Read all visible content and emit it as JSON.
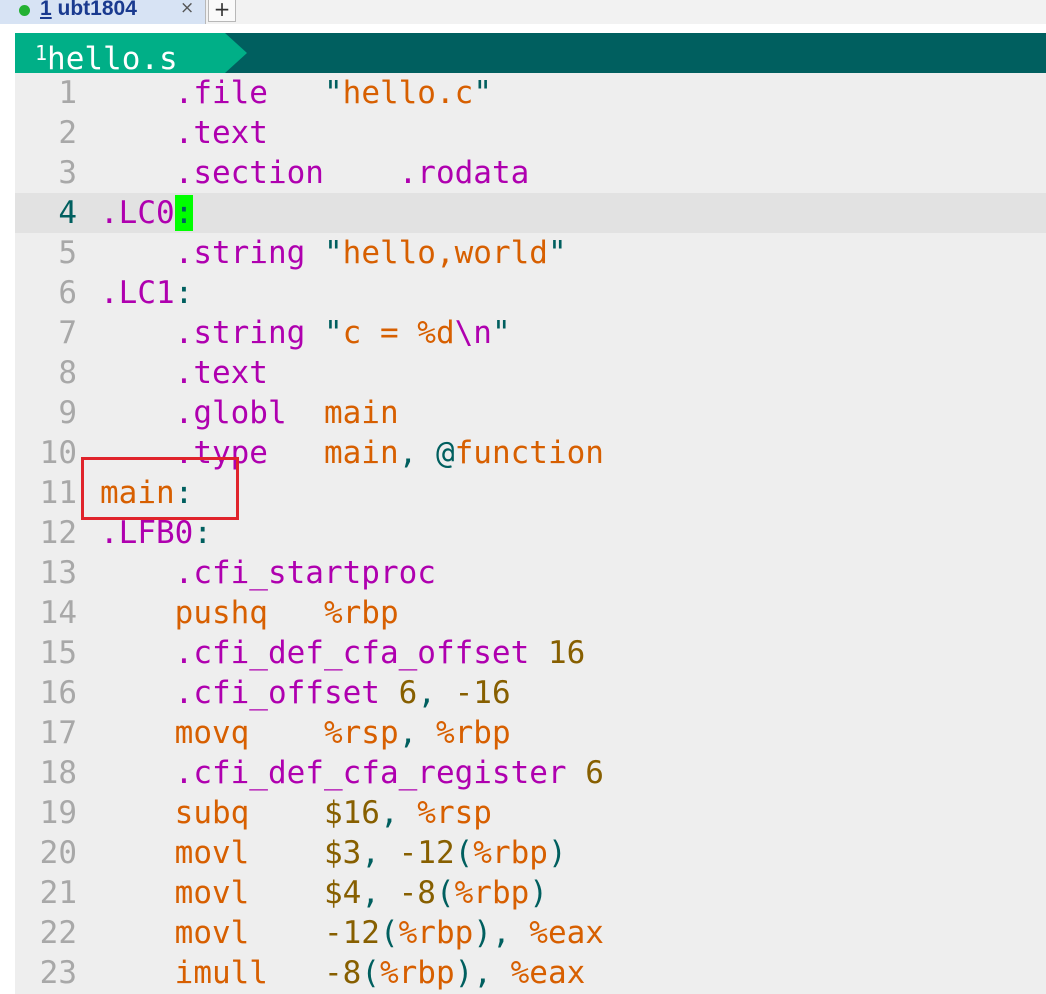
{
  "tab": {
    "number": "1",
    "title": "ubt1804",
    "close_icon": "×",
    "add_icon": "+"
  },
  "buffer": {
    "index": "1",
    "filename": "hello.s"
  },
  "lines": [
    {
      "n": "1",
      "tokens": [
        [
          "    ",
          ""
        ],
        [
          ".file",
          "c-dir"
        ],
        [
          "   ",
          ""
        ],
        [
          "\"",
          "c-q"
        ],
        [
          "hello.c",
          "c-str"
        ],
        [
          "\"",
          "c-q"
        ]
      ]
    },
    {
      "n": "2",
      "tokens": [
        [
          "    ",
          ""
        ],
        [
          ".text",
          "c-dir"
        ]
      ]
    },
    {
      "n": "3",
      "tokens": [
        [
          "    ",
          ""
        ],
        [
          ".section",
          "c-dir"
        ],
        [
          "    ",
          ""
        ],
        [
          ".rodata",
          "c-dir"
        ]
      ]
    },
    {
      "n": "4",
      "cursorline": true,
      "tokens": [
        [
          ".LC0",
          "c-lbl"
        ],
        [
          ":",
          "cursor"
        ]
      ]
    },
    {
      "n": "5",
      "tokens": [
        [
          "    ",
          ""
        ],
        [
          ".string",
          "c-dir"
        ],
        [
          " ",
          ""
        ],
        [
          "\"",
          "c-q"
        ],
        [
          "hello,world",
          "c-str"
        ],
        [
          "\"",
          "c-q"
        ]
      ]
    },
    {
      "n": "6",
      "tokens": [
        [
          ".LC1",
          "c-lbl"
        ],
        [
          ":",
          "c-punc"
        ]
      ]
    },
    {
      "n": "7",
      "tokens": [
        [
          "    ",
          ""
        ],
        [
          ".string",
          "c-dir"
        ],
        [
          " ",
          ""
        ],
        [
          "\"",
          "c-q"
        ],
        [
          "c = %d",
          "c-str"
        ],
        [
          "\\n",
          "c-esc"
        ],
        [
          "\"",
          "c-q"
        ]
      ]
    },
    {
      "n": "8",
      "tokens": [
        [
          "    ",
          ""
        ],
        [
          ".text",
          "c-dir"
        ]
      ]
    },
    {
      "n": "9",
      "tokens": [
        [
          "    ",
          ""
        ],
        [
          ".globl",
          "c-dir"
        ],
        [
          "  ",
          ""
        ],
        [
          "main",
          "c-sym"
        ]
      ]
    },
    {
      "n": "10",
      "tokens": [
        [
          "    ",
          ""
        ],
        [
          ".type",
          "c-dir"
        ],
        [
          "   ",
          ""
        ],
        [
          "main",
          "c-sym"
        ],
        [
          ", ",
          "c-punc"
        ],
        [
          "@",
          "c-at"
        ],
        [
          "function",
          "c-sym"
        ]
      ]
    },
    {
      "n": "11",
      "tokens": [
        [
          "main",
          "c-lblm"
        ],
        [
          ":",
          "c-punc"
        ]
      ]
    },
    {
      "n": "12",
      "tokens": [
        [
          ".LFB0",
          "c-lbl"
        ],
        [
          ":",
          "c-punc"
        ]
      ]
    },
    {
      "n": "13",
      "tokens": [
        [
          "    ",
          ""
        ],
        [
          ".cfi_startproc",
          "c-dir"
        ]
      ]
    },
    {
      "n": "14",
      "tokens": [
        [
          "    ",
          ""
        ],
        [
          "pushq",
          "c-op"
        ],
        [
          "   ",
          ""
        ],
        [
          "%rbp",
          "c-reg"
        ]
      ]
    },
    {
      "n": "15",
      "tokens": [
        [
          "    ",
          ""
        ],
        [
          ".cfi_def_cfa_offset",
          "c-dir"
        ],
        [
          " ",
          ""
        ],
        [
          "16",
          "c-num"
        ]
      ]
    },
    {
      "n": "16",
      "tokens": [
        [
          "    ",
          ""
        ],
        [
          ".cfi_offset",
          "c-dir"
        ],
        [
          " ",
          ""
        ],
        [
          "6",
          "c-num"
        ],
        [
          ", ",
          "c-punc"
        ],
        [
          "-16",
          "c-num"
        ]
      ]
    },
    {
      "n": "17",
      "tokens": [
        [
          "    ",
          ""
        ],
        [
          "movq",
          "c-op"
        ],
        [
          "    ",
          ""
        ],
        [
          "%rsp",
          "c-reg"
        ],
        [
          ", ",
          "c-punc"
        ],
        [
          "%rbp",
          "c-reg"
        ]
      ]
    },
    {
      "n": "18",
      "tokens": [
        [
          "    ",
          ""
        ],
        [
          ".cfi_def_cfa_register",
          "c-dir"
        ],
        [
          " ",
          ""
        ],
        [
          "6",
          "c-num"
        ]
      ]
    },
    {
      "n": "19",
      "tokens": [
        [
          "    ",
          ""
        ],
        [
          "subq",
          "c-op"
        ],
        [
          "    ",
          ""
        ],
        [
          "$16",
          "c-num"
        ],
        [
          ", ",
          "c-punc"
        ],
        [
          "%rsp",
          "c-reg"
        ]
      ]
    },
    {
      "n": "20",
      "tokens": [
        [
          "    ",
          ""
        ],
        [
          "movl",
          "c-op"
        ],
        [
          "    ",
          ""
        ],
        [
          "$3",
          "c-num"
        ],
        [
          ", ",
          "c-punc"
        ],
        [
          "-12",
          "c-num"
        ],
        [
          "(",
          "c-punc"
        ],
        [
          "%rbp",
          "c-reg"
        ],
        [
          ")",
          "c-punc"
        ]
      ]
    },
    {
      "n": "21",
      "tokens": [
        [
          "    ",
          ""
        ],
        [
          "movl",
          "c-op"
        ],
        [
          "    ",
          ""
        ],
        [
          "$4",
          "c-num"
        ],
        [
          ", ",
          "c-punc"
        ],
        [
          "-8",
          "c-num"
        ],
        [
          "(",
          "c-punc"
        ],
        [
          "%rbp",
          "c-reg"
        ],
        [
          ")",
          "c-punc"
        ]
      ]
    },
    {
      "n": "22",
      "tokens": [
        [
          "    ",
          ""
        ],
        [
          "movl",
          "c-op"
        ],
        [
          "    ",
          ""
        ],
        [
          "-12",
          "c-num"
        ],
        [
          "(",
          "c-punc"
        ],
        [
          "%rbp",
          "c-reg"
        ],
        [
          ")",
          "c-punc"
        ],
        [
          ", ",
          "c-punc"
        ],
        [
          "%eax",
          "c-reg"
        ]
      ]
    },
    {
      "n": "23",
      "tokens": [
        [
          "    ",
          ""
        ],
        [
          "imull",
          "c-op"
        ],
        [
          "   ",
          ""
        ],
        [
          "-8",
          "c-num"
        ],
        [
          "(",
          "c-punc"
        ],
        [
          "%rbp",
          "c-reg"
        ],
        [
          ")",
          "c-punc"
        ],
        [
          ", ",
          "c-punc"
        ],
        [
          "%eax",
          "c-reg"
        ]
      ]
    }
  ],
  "colors": {
    "bufferline_bg": "#005f5f",
    "buffer_tab_bg": "#00af87",
    "editor_bg": "#eeeeee",
    "cursor": "#00ff00",
    "annotation_box": "#e0232b"
  }
}
